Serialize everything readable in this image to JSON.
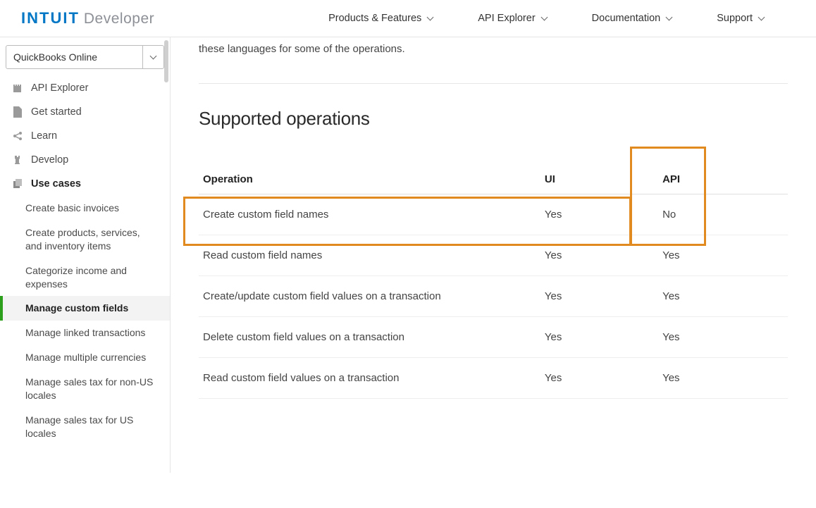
{
  "header": {
    "logo_brand": "INTUIT",
    "logo_sub": "Developer",
    "nav": [
      {
        "label": "Products & Features"
      },
      {
        "label": "API Explorer"
      },
      {
        "label": "Documentation"
      },
      {
        "label": "Support"
      }
    ]
  },
  "sidebar": {
    "dropdown_value": "QuickBooks Online",
    "items": [
      {
        "label": "API Explorer",
        "icon": "castle"
      },
      {
        "label": "Get started",
        "icon": "doc"
      },
      {
        "label": "Learn",
        "icon": "share"
      },
      {
        "label": "Develop",
        "icon": "rook"
      },
      {
        "label": "Use cases",
        "icon": "copy",
        "bold": true
      }
    ],
    "usecases": [
      "Create basic invoices",
      "Create products, services, and inventory items",
      "Categorize income and expenses",
      "Manage custom fields",
      "Manage linked transactions",
      "Manage multiple currencies",
      "Manage sales tax for non-US locales",
      "Manage sales tax for US locales"
    ],
    "active_usecase_index": 3
  },
  "main": {
    "intro_fragment": "these languages for some of the operations.",
    "section_title": "Supported operations",
    "table": {
      "headers": {
        "op": "Operation",
        "ui": "UI",
        "api": "API"
      },
      "rows": [
        {
          "op": "Create custom field names",
          "ui": "Yes",
          "api": "No"
        },
        {
          "op": "Read custom field names",
          "ui": "Yes",
          "api": "Yes"
        },
        {
          "op": "Create/update custom field values on a transaction",
          "ui": "Yes",
          "api": "Yes"
        },
        {
          "op": "Delete custom field values on a transaction",
          "ui": "Yes",
          "api": "Yes"
        },
        {
          "op": "Read custom field values on a transaction",
          "ui": "Yes",
          "api": "Yes"
        }
      ]
    }
  }
}
